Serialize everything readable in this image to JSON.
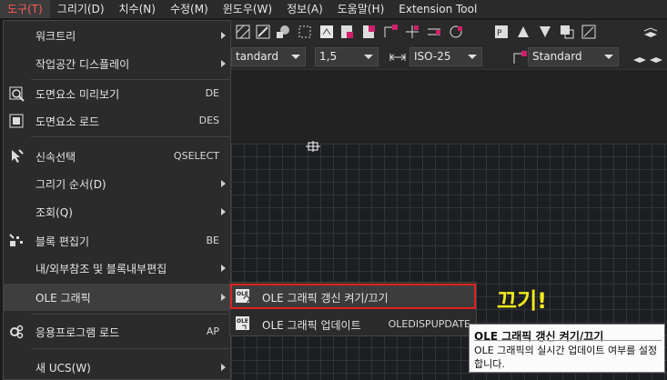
{
  "menubar": {
    "items": [
      "도구(T)",
      "그리기(D)",
      "치수(N)",
      "수정(M)",
      "윈도우(W)",
      "정보(A)",
      "도움말(H)",
      "Extension Tool"
    ],
    "active_index": 0
  },
  "toolbar": {
    "combo_textstyle": "tandard",
    "combo_scale": "1,5",
    "combo_dimstyle": "ISO-25",
    "combo_tablestyle": "Standard"
  },
  "menu": {
    "items": [
      {
        "label": "워크트리",
        "shortcut": "",
        "submenu": true,
        "icon": ""
      },
      {
        "label": "작업공간 디스플레이",
        "shortcut": "",
        "submenu": true,
        "icon": ""
      },
      {
        "label": "도면요소 미리보기",
        "shortcut": "DE",
        "submenu": false,
        "icon": "preview-icon"
      },
      {
        "label": "도면요소 로드",
        "shortcut": "DES",
        "submenu": false,
        "icon": "load-icon"
      },
      {
        "label": "신속선택",
        "shortcut": "QSELECT",
        "submenu": false,
        "icon": "quick-select-icon"
      },
      {
        "label": "그리기 순서(D)",
        "shortcut": "",
        "submenu": true,
        "icon": ""
      },
      {
        "label": "조회(Q)",
        "shortcut": "",
        "submenu": true,
        "icon": ""
      },
      {
        "label": "블록 편집기",
        "shortcut": "BE",
        "submenu": false,
        "icon": "block-editor-icon"
      },
      {
        "label": "내/외부참조 및 블록내부편집",
        "shortcut": "",
        "submenu": true,
        "icon": ""
      },
      {
        "label": "OLE 그래픽",
        "shortcut": "",
        "submenu": true,
        "icon": ""
      },
      {
        "label": "응용프로그램 로드",
        "shortcut": "AP",
        "submenu": false,
        "icon": "app-load-icon"
      },
      {
        "label": "새 UCS(W)",
        "shortcut": "",
        "submenu": true,
        "icon": ""
      }
    ]
  },
  "submenu": {
    "items": [
      {
        "label": "OLE 그래픽 갱신 켜기/끄기",
        "shortcut": "",
        "icon_text": "OLE"
      },
      {
        "label": "OLE 그래픽 업데이트",
        "shortcut": "OLEDISPUPDATE",
        "icon_text": "OLE"
      }
    ]
  },
  "annotation": "끄기!",
  "tooltip": {
    "title": "OLE 그래픽 갱신 켜기/끄기",
    "body": "OLE 그래픽의 실시간 업데이트 여부를 설정합니다."
  },
  "colors": {
    "highlight_border": "#e02020",
    "annotation": "#f3ea1a",
    "active_menu": "#ff5a5a"
  }
}
